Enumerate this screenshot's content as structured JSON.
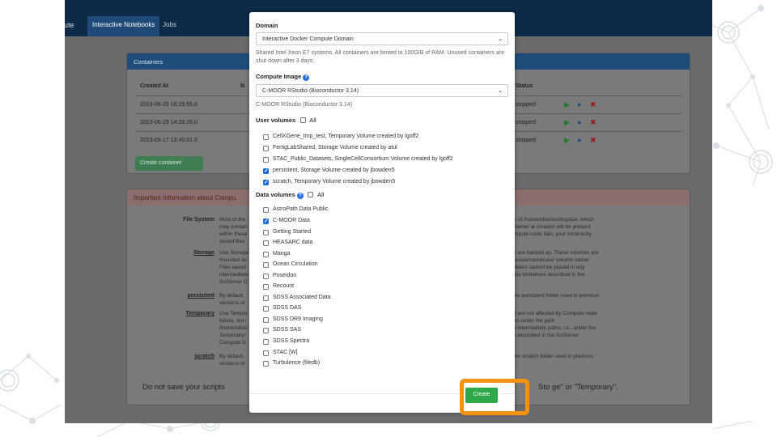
{
  "nav": {
    "brand_fragment": "pute",
    "items": [
      "Interactive Notebooks",
      "Jobs"
    ]
  },
  "containers": {
    "title": "Containers",
    "columns": [
      "Created At",
      "N",
      "Status"
    ],
    "rows": [
      {
        "created": "2023-06-29 16:25:55.0",
        "status": "stopped"
      },
      {
        "created": "2023-06-29 14:28:26.0",
        "status": "stopped"
      },
      {
        "created": "2023-05-17 13:40:01.0",
        "status": "stopped"
      }
    ],
    "create_button": "Create container"
  },
  "info": {
    "title": "Important Information about Compu",
    "sections": [
      {
        "key": "File System",
        "left": "Most of the\nmay contain\nwithin these\nstored files",
        "right": "w is of /home/idies/workspace, which\ncontainer at creation will be present\nCompute node fails, your incorrectly"
      },
      {
        "key": "Storage",
        "left": "Use Storage\nmounted ac\nFiles saved\nintermediate\nSciServer C",
        "right": "lder are backed up. These volumes are\nrage/username/user volume name/.\nd folders cannot be placed in any\nd size limitations described in the"
      },
      {
        "key": "persistent",
        "left": "By default, \nversions of",
        "right": "same persistent folder used in previous"
      },
      {
        "key": "Temporary",
        "left": "Use Tempor\nfailure, but i\n/home/idies/\nTemporary/\nCompute D",
        "right": "and are not affected by Compute node\nthem under the path\nany intermediate paths, i.e., under the\nons described in the SciServer"
      },
      {
        "key": "scratch",
        "left": "By default, \nversions of",
        "right": "same scratch folder used in previous"
      }
    ],
    "footer_left": "Do not save your scripts",
    "footer_right": "Sto  ge\" or \"Temporary\"."
  },
  "modal": {
    "domain_label": "Domain",
    "domain_value": "Interactive Docker Compute Domain",
    "domain_help": "Shared Intel Xeon E7 systems. All containers are limited to 100GIB of RAM. Unused containers are shut down after 3 days.",
    "image_label": "Compute Image",
    "image_value": "C-MOOR RStudio (Bioconductor 3.14)",
    "image_help": "C-MOOR RStudio (Bioconductor 3.14)",
    "user_volumes_label": "User volumes",
    "all_label": "All",
    "user_volumes": [
      {
        "label": "CellXGene_tmp_test, Temporary Volume created by lgoff2",
        "checked": false
      },
      {
        "label": "FertigLabShared, Storage Volume created by atul",
        "checked": false
      },
      {
        "label": "STAC_Public_Datasets, SingleCellConsortium Volume created by lgoff2",
        "checked": false
      },
      {
        "label": "persistent, Storage Volume created by jbowden5",
        "checked": true
      },
      {
        "label": "scratch, Temporary Volume created by jbowden5",
        "checked": true
      }
    ],
    "data_volumes_label": "Data volumes",
    "data_volumes": [
      {
        "label": "AstroPath Data Public",
        "checked": false
      },
      {
        "label": "C-MOOR Data",
        "checked": true
      },
      {
        "label": "Getting Started",
        "checked": false
      },
      {
        "label": "HEASARC data",
        "checked": false
      },
      {
        "label": "Manga",
        "checked": false
      },
      {
        "label": "Ocean Circulation",
        "checked": false
      },
      {
        "label": "Poseidon",
        "checked": false
      },
      {
        "label": "Recount",
        "checked": false
      },
      {
        "label": "SDSS Associated Data",
        "checked": false
      },
      {
        "label": "SDSS DAS",
        "checked": false
      },
      {
        "label": "SDSS DR9 Imaging",
        "checked": false
      },
      {
        "label": "SDSS SAS",
        "checked": false
      },
      {
        "label": "SDSS Spectra",
        "checked": false
      },
      {
        "label": "STAC [W]",
        "checked": false
      },
      {
        "label": "Turbulence (filedb)",
        "checked": false
      }
    ],
    "create_button": "Create"
  },
  "colors": {
    "navbar": "#0d2a47",
    "panel_header": "#1e4d7a",
    "create_green": "#2ea84a",
    "highlight_orange": "#f5920f",
    "checkbox_blue": "#1d6ad6"
  }
}
